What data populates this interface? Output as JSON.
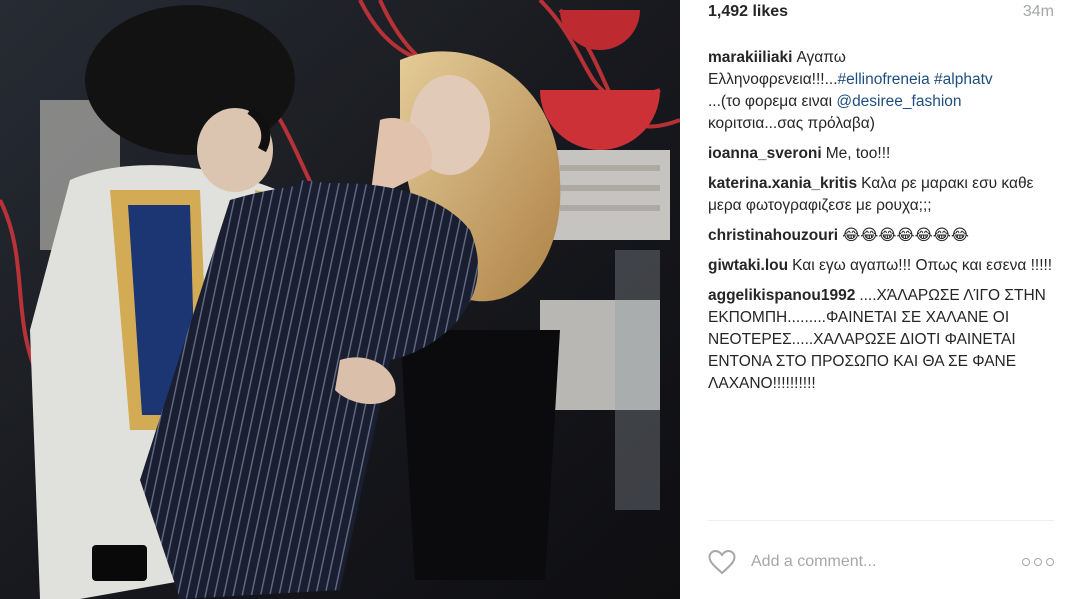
{
  "post": {
    "likes": "1,492 likes",
    "time": "34m"
  },
  "comments": [
    {
      "user": "marakiiliaki",
      "text_before": "Αγαπω Ελληνοφρενεια!!!...",
      "tag1": "#ellinofreneia",
      "tag2": "#alphatv",
      "text_mid": "...(το φορεμα ειναι",
      "mention": "@desiree_fashion",
      "text_after": "κοριτσια...σας πρόλαβα)"
    },
    {
      "user": "ioanna_sveroni",
      "text": "Me, too!!!"
    },
    {
      "user": "katerina.xania_kritis",
      "text": "Καλα ρε μαρακι εσυ καθε μερα φωτογραφιζεσε με ρουχα;;;"
    },
    {
      "user": "christinahouzouri",
      "text": "😂😂😂😂😂😂😂"
    },
    {
      "user": "giwtaki.lou",
      "text": "Και εγω αγαπω!!! Οπως και εσενα !!!!!"
    },
    {
      "user": "aggelikispanou1992",
      "text": "....ΧΆΛΑΡΩΣΕ ΛΊΓΟ ΣΤΗΝ ΕΚΠΟΜΠΗ.........ΦΑΙΝΕΤΑΙ ΣΕ ΧΑΛΑΝΕ ΟΙ ΝΕΟΤΕΡΕΣ.....ΧΑΛΑΡΩΣΕ ΔΙΟΤΙ ΦΑΙΝΕΤΑΙ ΕΝΤΟΝΑ ΣΤΟ ΠΡΟΣΩΠΟ ΚΑΙ ΘΑ ΣΕ ΦΑΝΕ ΛΑΧΑΝΟ!!!!!!!!!!"
    }
  ],
  "comment_box": {
    "placeholder": "Add a comment..."
  },
  "icons": {
    "like": "heart-icon",
    "more": "more-options-icon"
  },
  "colors": {
    "link": "#1e4e7e",
    "muted": "#a5a7aa",
    "text": "#262626"
  }
}
